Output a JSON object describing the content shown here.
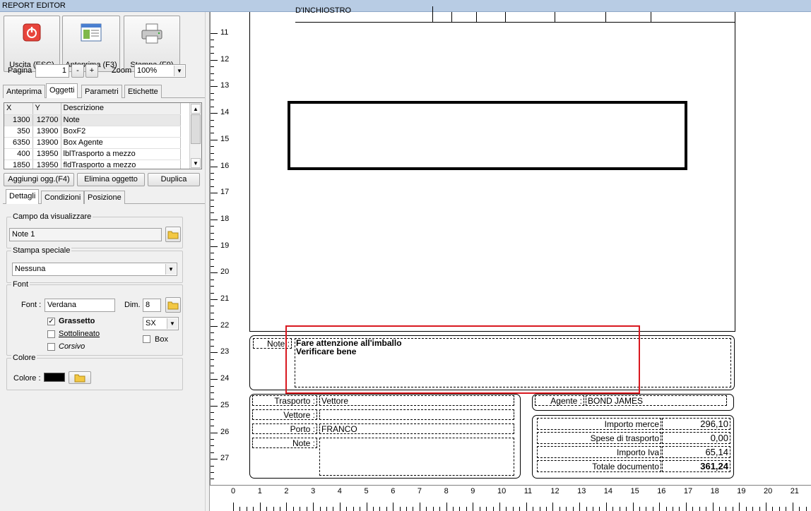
{
  "window": {
    "title": "REPORT EDITOR"
  },
  "toolbar": {
    "exit_label": "Uscita (ESC)",
    "preview_label": "Anteprima (F3)",
    "print_label": "Stampa (F9)"
  },
  "pager": {
    "label": "Pagina",
    "value": "1",
    "minus": "-",
    "plus": "+",
    "zoom_label": "Zoom",
    "zoom_value": "100%"
  },
  "top_tabs": [
    "Anteprima",
    "Oggetti",
    "Parametri",
    "Etichette"
  ],
  "objects_table": {
    "headers": [
      "X",
      "Y",
      "Descrizione"
    ],
    "rows": [
      [
        "1300",
        "12700",
        "Note"
      ],
      [
        "350",
        "13900",
        "BoxF2"
      ],
      [
        "6350",
        "13900",
        "Box Agente"
      ],
      [
        "400",
        "13950",
        "lblTrasporto a mezzo"
      ],
      [
        "1850",
        "13950",
        "fldTrasporto a mezzo"
      ]
    ]
  },
  "object_buttons": {
    "add": "Aggiungi ogg.(F4)",
    "delete": "Elimina oggetto",
    "duplicate": "Duplica"
  },
  "detail_tabs": [
    "Dettagli",
    "Condizioni",
    "Posizione"
  ],
  "campo": {
    "title": "Campo da visualizzare",
    "value": "Note 1"
  },
  "stampa_speciale": {
    "title": "Stampa speciale",
    "value": "Nessuna"
  },
  "font": {
    "title": "Font",
    "font_label": "Font :",
    "font_value": "Verdana",
    "dim_label": "Dim.",
    "dim_value": "8",
    "bold_label": "Grassetto",
    "underline_label": "Sottolineato",
    "italic_label": "Corsivo",
    "align_value": "SX",
    "box_label": "Box"
  },
  "colore": {
    "title": "Colore",
    "label": "Colore :",
    "swatch": "#000000"
  },
  "vruler": [
    "11",
    "12",
    "13",
    "14",
    "15",
    "16",
    "17",
    "18",
    "19",
    "20",
    "21",
    "22",
    "23",
    "24",
    "25",
    "26",
    "27"
  ],
  "hruler": [
    "0",
    "1",
    "2",
    "3",
    "4",
    "5",
    "6",
    "7",
    "8",
    "9",
    "10",
    "11",
    "12",
    "13",
    "14",
    "15",
    "16",
    "17",
    "18",
    "19",
    "20",
    "21"
  ],
  "report": {
    "top_cut_text": "D'INCHIOSTRO",
    "note_label": "Note :",
    "note_line1": "Fare attenzione all'imballo",
    "note_line2": "Verificare bene",
    "trasporto_label": "Trasporto :",
    "trasporto_value": "Vettore",
    "vettore_label": "Vettore :",
    "vettore_value": "",
    "porto_label": "Porto :",
    "porto_value": "FRANCO",
    "note2_label": "Note :",
    "agente_label": "Agente :",
    "agente_value": "BOND JAMES",
    "totals": [
      {
        "label": "Importo merce",
        "value": "296,10"
      },
      {
        "label": "Spese di trasporto",
        "value": "0,00"
      },
      {
        "label": "Importo Iva",
        "value": "65,14"
      },
      {
        "label": "Totale documento",
        "value": "361,24"
      }
    ]
  },
  "colors": {
    "selection": "#d9181f",
    "title_bar": "#b8cce4"
  }
}
